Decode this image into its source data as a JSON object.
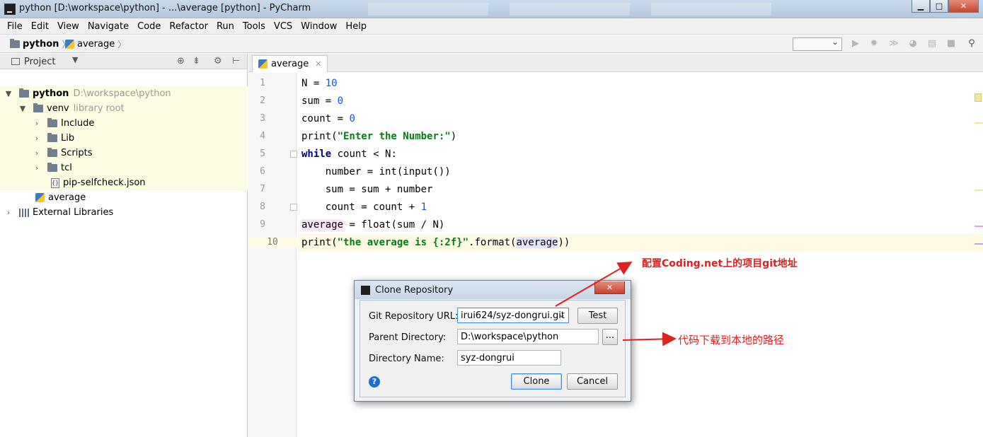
{
  "window": {
    "title": "python [D:\\workspace\\python] - ...\\average [python] - PyCharm",
    "minimize": "▁",
    "maximize": "□",
    "close": "✕"
  },
  "menu": [
    "File",
    "Edit",
    "View",
    "Navigate",
    "Code",
    "Refactor",
    "Run",
    "Tools",
    "VCS",
    "Window",
    "Help"
  ],
  "breadcrumb": {
    "project": "python",
    "file": "average"
  },
  "project_panel": {
    "header": "Project",
    "tree": {
      "root": {
        "name": "python",
        "path": "D:\\workspace\\python"
      },
      "venv": {
        "name": "venv",
        "note": "library root"
      },
      "children": [
        "Include",
        "Lib",
        "Scripts",
        "tcl"
      ],
      "json_file": "pip-selfcheck.json",
      "file": "average",
      "external": "External Libraries"
    }
  },
  "editor": {
    "tab": "average",
    "line_numbers": [
      "1",
      "2",
      "3",
      "4",
      "5",
      "6",
      "7",
      "8",
      "9",
      "10"
    ],
    "current_line": 10,
    "code": [
      {
        "t": "N = ",
        "n": "10"
      },
      {
        "t": "sum = ",
        "n": "0"
      },
      {
        "t": "count = ",
        "n": "0"
      },
      {
        "pre": "print(",
        "s": "\"Enter the Number:\"",
        "post": ")"
      },
      {
        "kw": "while",
        "rest": " count < N:"
      },
      {
        "text": "    number = int(input())"
      },
      {
        "text": "    sum = sum + number"
      },
      {
        "t": "    count = count + ",
        "n": "1"
      },
      {
        "v": "average",
        "rest": " = float(sum / N)"
      },
      {
        "pre": "print(",
        "s": "\"the average is {:2f}\"",
        "mid": ".format(",
        "v": "average",
        "post": "))"
      }
    ]
  },
  "dialog": {
    "title": "Clone Repository",
    "git_url_label": "Git Repository URL:",
    "git_url_value": "irui624/syz-dongrui.git",
    "test_button": "Test",
    "parent_dir_label": "Parent Directory:",
    "parent_dir_value": "D:\\workspace\\python",
    "browse_button": "...",
    "dir_name_label": "Directory Name:",
    "dir_name_value": "syz-dongrui",
    "clone_button": "Clone",
    "cancel_button": "Cancel",
    "help": "?"
  },
  "annotations": {
    "top": "配置Coding.net上的项目git地址",
    "right": "代码下载到本地的路径",
    "color": "#e02020"
  }
}
